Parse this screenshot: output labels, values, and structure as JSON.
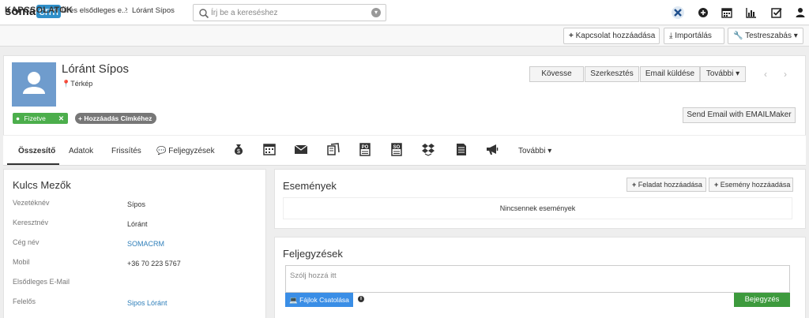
{
  "app": {
    "logo_main": "soma",
    "logo_accent": "crm",
    "search_placeholder": "Írj be a kereséshez"
  },
  "topbar_icons": [
    "x-logo-icon",
    "plus-circle-icon",
    "calendar-icon",
    "bar-chart-icon",
    "checkbox-icon",
    "user-icon"
  ],
  "breadcrumb": {
    "root": "KAPCSOLATOK",
    "item1": "Üres elsődleges e...",
    "item2": "Lóránt Sípos"
  },
  "header_buttons": {
    "add_contact": "Kapcsolat hozzáadása",
    "import": "Importálás",
    "customize": "Testreszabás"
  },
  "record": {
    "name": "Lóránt Sípos",
    "map": "Térkép",
    "tag": "Fizetve",
    "add_tag": "Hozzáadás Címkéhez"
  },
  "actions": {
    "follow": "Kövesse",
    "edit": "Szerkesztés",
    "send_email": "Email küldése",
    "more": "További",
    "emailmaker": "Send Email with EMAILMaker"
  },
  "tabs": {
    "summary": "Összesítő",
    "details": "Adatok",
    "updates": "Frissítés",
    "comments": "Feljegyzések",
    "more": "További",
    "module_icons": [
      "money-bag-icon",
      "calendar-icon",
      "envelope-icon",
      "documents-icon",
      "purchase-order-icon",
      "sales-order-icon",
      "dropbox-icon",
      "document-icon",
      "megaphone-icon"
    ]
  },
  "key_fields": {
    "title": "Kulcs Mezők",
    "rows": [
      {
        "label": "Vezetéknév",
        "value": "Sípos"
      },
      {
        "label": "Keresztnév",
        "value": "Lóránt"
      },
      {
        "label": "Cég név",
        "value": "SOMACRM"
      },
      {
        "label": "Mobil",
        "value": "+36 70 223 5767"
      },
      {
        "label": "Elsődleges E-Mail",
        "value": ""
      },
      {
        "label": "Felelős",
        "value": "Sipos Lóránt"
      }
    ]
  },
  "events": {
    "title": "Események",
    "add_task": "Feladat hozzáadása",
    "add_event": "Esemény hozzáadása",
    "empty": "Nincsennek események"
  },
  "notes": {
    "title": "Feljegyzések",
    "placeholder": "Szólj hozzá itt",
    "attach": "Fájlok Csatolása",
    "save": "Bejegyzés"
  },
  "colors": {
    "accent": "#2f8fc9",
    "avatar": "#6f9ccd",
    "tag_green": "#4cae4c",
    "save_green": "#3d9a3d",
    "link": "#2f7fba"
  }
}
